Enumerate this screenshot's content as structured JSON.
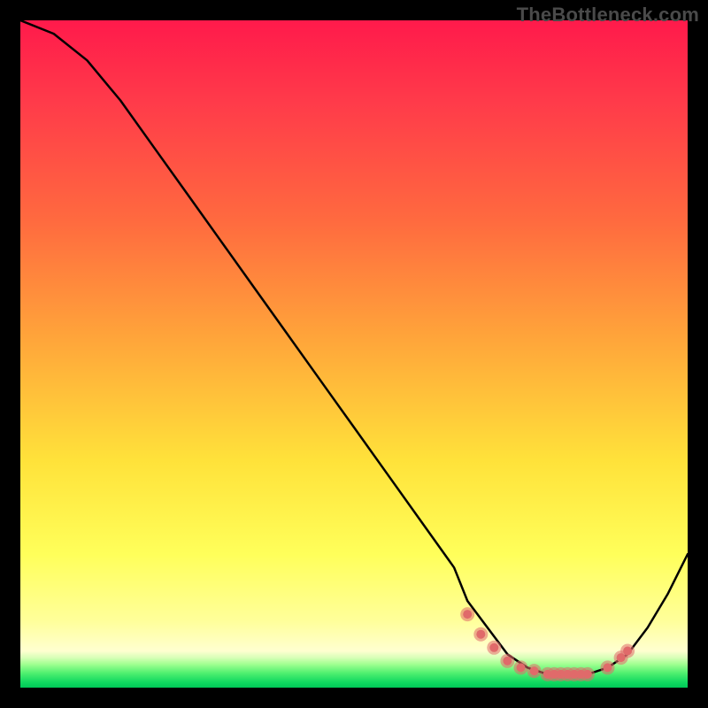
{
  "watermark": "TheBottleneck.com",
  "colors": {
    "marker": "#e06a6a",
    "curve": "#000000"
  },
  "chart_data": {
    "type": "line",
    "title": "",
    "xlabel": "",
    "ylabel": "",
    "xlim": [
      0,
      100
    ],
    "ylim": [
      0,
      100
    ],
    "series": [
      {
        "name": "bottleneck-curve",
        "x": [
          0,
          5,
          10,
          15,
          20,
          25,
          30,
          35,
          40,
          45,
          50,
          55,
          60,
          65,
          67,
          70,
          73,
          76,
          79,
          82,
          85,
          88,
          91,
          94,
          97,
          100
        ],
        "y": [
          100,
          98,
          94,
          88,
          81,
          74,
          67,
          60,
          53,
          46,
          39,
          32,
          25,
          18,
          13,
          9,
          5,
          3,
          2,
          2,
          2,
          3,
          5,
          9,
          14,
          20
        ]
      }
    ],
    "markers": {
      "name": "optimal-range",
      "x": [
        67,
        69,
        71,
        73,
        75,
        77,
        79,
        80,
        81,
        82,
        83,
        84,
        85,
        88,
        90,
        91
      ],
      "y": [
        11,
        8,
        6,
        4,
        3,
        2.5,
        2,
        2,
        2,
        2,
        2,
        2,
        2,
        3,
        4.5,
        5.5
      ]
    }
  }
}
